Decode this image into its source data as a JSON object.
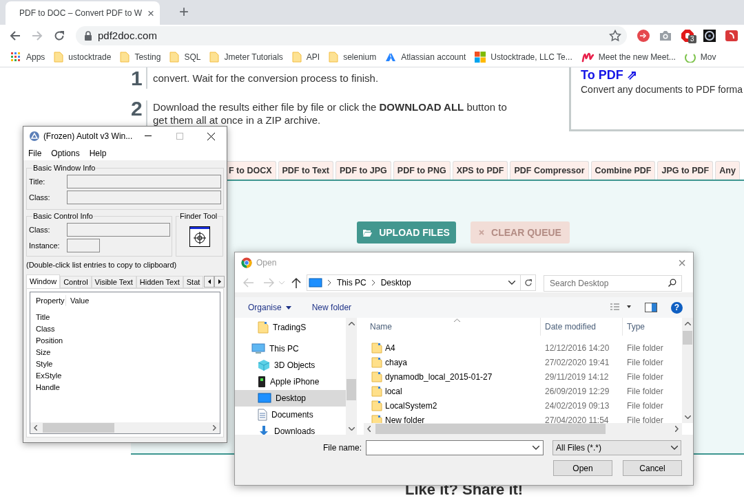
{
  "browser": {
    "tab": {
      "title": "PDF to DOC – Convert PDF to W",
      "close": "×"
    },
    "new_tab": "+",
    "address": "pdf2doc.com",
    "forward_disabled": true,
    "extension_badge": "3",
    "bookmarks": [
      {
        "label": "Apps",
        "kind": "apps"
      },
      {
        "label": "ustocktrade",
        "kind": "folder"
      },
      {
        "label": "Testing",
        "kind": "folder"
      },
      {
        "label": "SQL",
        "kind": "folder"
      },
      {
        "label": "Jmeter Tutorials",
        "kind": "folder"
      },
      {
        "label": "API",
        "kind": "folder"
      },
      {
        "label": "selenium",
        "kind": "folder"
      },
      {
        "label": "Atlassian account",
        "kind": "triangle"
      },
      {
        "label": "Ustocktrade, LLC Te...",
        "kind": "squares"
      },
      {
        "label": "Meet the new Meet...",
        "kind": "wave"
      },
      {
        "label": "Mov",
        "kind": "ring"
      }
    ]
  },
  "page": {
    "steps": [
      {
        "number": "1",
        "text": "convert. Wait for the conversion process to finish."
      },
      {
        "number": "2",
        "text": "Download the results either file by file or click the **DOWNLOAD ALL** button to get them all at once in a ZIP archive."
      }
    ],
    "side_card": {
      "link": "To PDF ⇗",
      "text": "Convert any documents to PDF forma"
    },
    "tool_tabs": [
      "F to DOCX",
      "PDF to Text",
      "PDF to JPG",
      "PDF to PNG",
      "XPS to PDF",
      "PDF Compressor",
      "Combine PDF",
      "JPG to PDF",
      "Any"
    ],
    "upload_button": {
      "label": "UPLOAD FILES",
      "disabled": false
    },
    "clear_button": {
      "label": "CLEAR QUEUE",
      "disabled": true
    },
    "share_heading": "Like it? Share it!"
  },
  "autoit": {
    "title": "(Frozen) AutoIt v3 Win...",
    "menu": [
      "File",
      "Options",
      "Help"
    ],
    "window_group": {
      "legend": "Basic Window Info",
      "fields": [
        "Title:",
        "Class:"
      ]
    },
    "control_group": {
      "legend": "Basic Control Info",
      "fields": [
        "Class:",
        "Instance:"
      ]
    },
    "finder_legend": "Finder Tool",
    "hint": "(Double-click list entries to copy to clipboard)",
    "tabs": [
      {
        "label": "Window",
        "selected": true
      },
      {
        "label": "Control",
        "selected": false
      },
      {
        "label": "Visible Text",
        "selected": false
      },
      {
        "label": "Hidden Text",
        "selected": false
      },
      {
        "label": "Stat",
        "selected": false
      }
    ],
    "columns": [
      "Property",
      "Value"
    ],
    "rows": [
      "Title",
      "Class",
      "Position",
      "Size",
      "Style",
      "ExStyle",
      "Handle"
    ]
  },
  "open_dialog": {
    "title": "Open",
    "close": "×",
    "breadcrumb": [
      "This PC",
      "Desktop"
    ],
    "search_placeholder": "Search Desktop",
    "toolbar": [
      "Organise",
      "New folder"
    ],
    "help": "?",
    "nav": [
      {
        "label": "TradingS",
        "kind": "folder",
        "selected": false
      },
      {
        "label": "This PC",
        "kind": "pc",
        "selected": false
      },
      {
        "label": "3D Objects",
        "kind": "cube",
        "selected": false
      },
      {
        "label": "Apple iPhone",
        "kind": "phone",
        "selected": false
      },
      {
        "label": "Desktop",
        "kind": "desktop",
        "selected": true
      },
      {
        "label": "Documents",
        "kind": "document",
        "selected": false
      },
      {
        "label": "Downloads",
        "kind": "download",
        "selected": false
      }
    ],
    "columns": [
      "Name",
      "Date modified",
      "Type"
    ],
    "files": [
      {
        "name": "A4",
        "date": "12/12/2016 14:20",
        "type": "File folder"
      },
      {
        "name": "chaya",
        "date": "27/02/2020 19:41",
        "type": "File folder"
      },
      {
        "name": "dynamodb_local_2015-01-27",
        "date": "29/11/2019 14:12",
        "type": "File folder"
      },
      {
        "name": "local",
        "date": "26/09/2019 12:29",
        "type": "File folder"
      },
      {
        "name": "LocalSystem2",
        "date": "24/02/2019 09:13",
        "type": "File folder"
      },
      {
        "name": "New folder",
        "date": "27/04/2020 11:54",
        "type": "File folder"
      }
    ],
    "file_name_label": "File name:",
    "filter": "All Files (*.*)",
    "buttons": [
      "Open",
      "Cancel"
    ]
  }
}
